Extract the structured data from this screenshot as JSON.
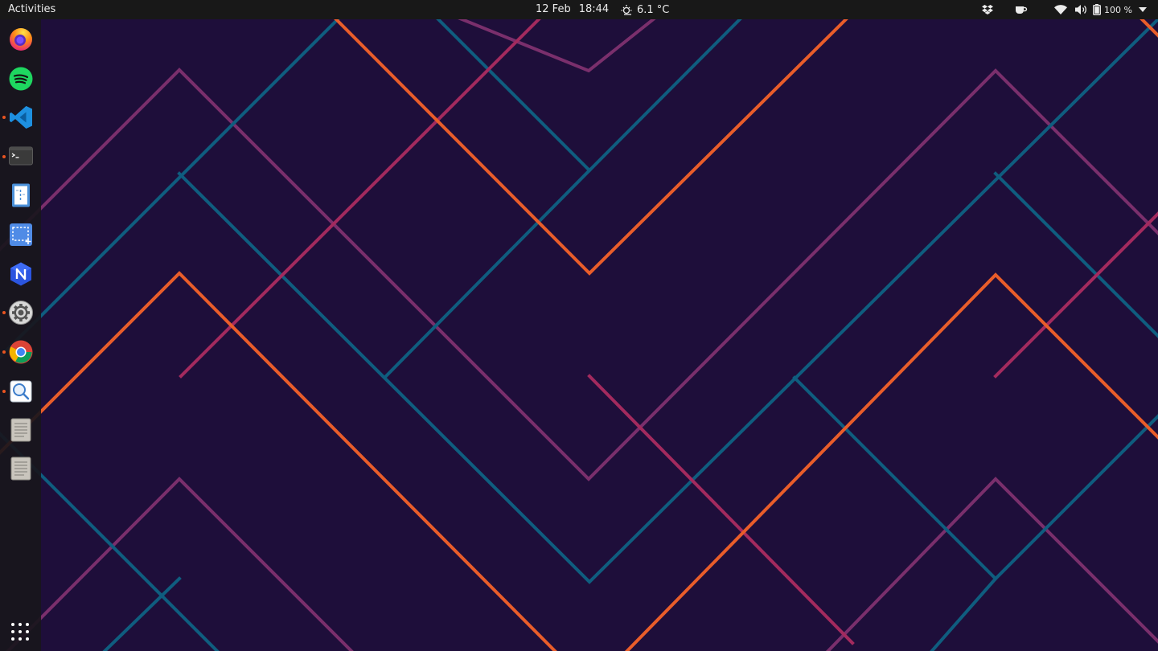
{
  "topbar": {
    "activities": "Activities",
    "date": "12 Feb",
    "time": "18:44",
    "weather": "6.1 °C",
    "battery": "100 %"
  },
  "dock": {
    "items": [
      {
        "name": "Firefox",
        "icon": "firefox-icon",
        "running": false
      },
      {
        "name": "Spotify",
        "icon": "spotify-icon",
        "running": false
      },
      {
        "name": "Visual Studio Code",
        "icon": "vscode-icon",
        "running": true
      },
      {
        "name": "Terminal",
        "icon": "terminal-icon",
        "running": true
      },
      {
        "name": "Text Editor",
        "icon": "text-editor-icon",
        "running": false
      },
      {
        "name": "Screenshot",
        "icon": "screenshot-icon",
        "running": false
      },
      {
        "name": "Joplin / Notes",
        "icon": "notes-app-icon",
        "running": false
      },
      {
        "name": "Settings",
        "icon": "settings-icon",
        "running": true
      },
      {
        "name": "Google Chrome",
        "icon": "chrome-icon",
        "running": true
      },
      {
        "name": "Image Viewer",
        "icon": "image-viewer-icon",
        "running": true
      },
      {
        "name": "Document",
        "icon": "document-icon",
        "running": false
      },
      {
        "name": "Document",
        "icon": "document-icon",
        "running": false
      }
    ],
    "show_apps": "show-applications-icon"
  },
  "colors": {
    "background": "#1e0e3a",
    "orange": "#e95d2a",
    "teal": "#0f5d7f",
    "plum": "#7a2f6c",
    "magenta": "#a32a5e"
  }
}
